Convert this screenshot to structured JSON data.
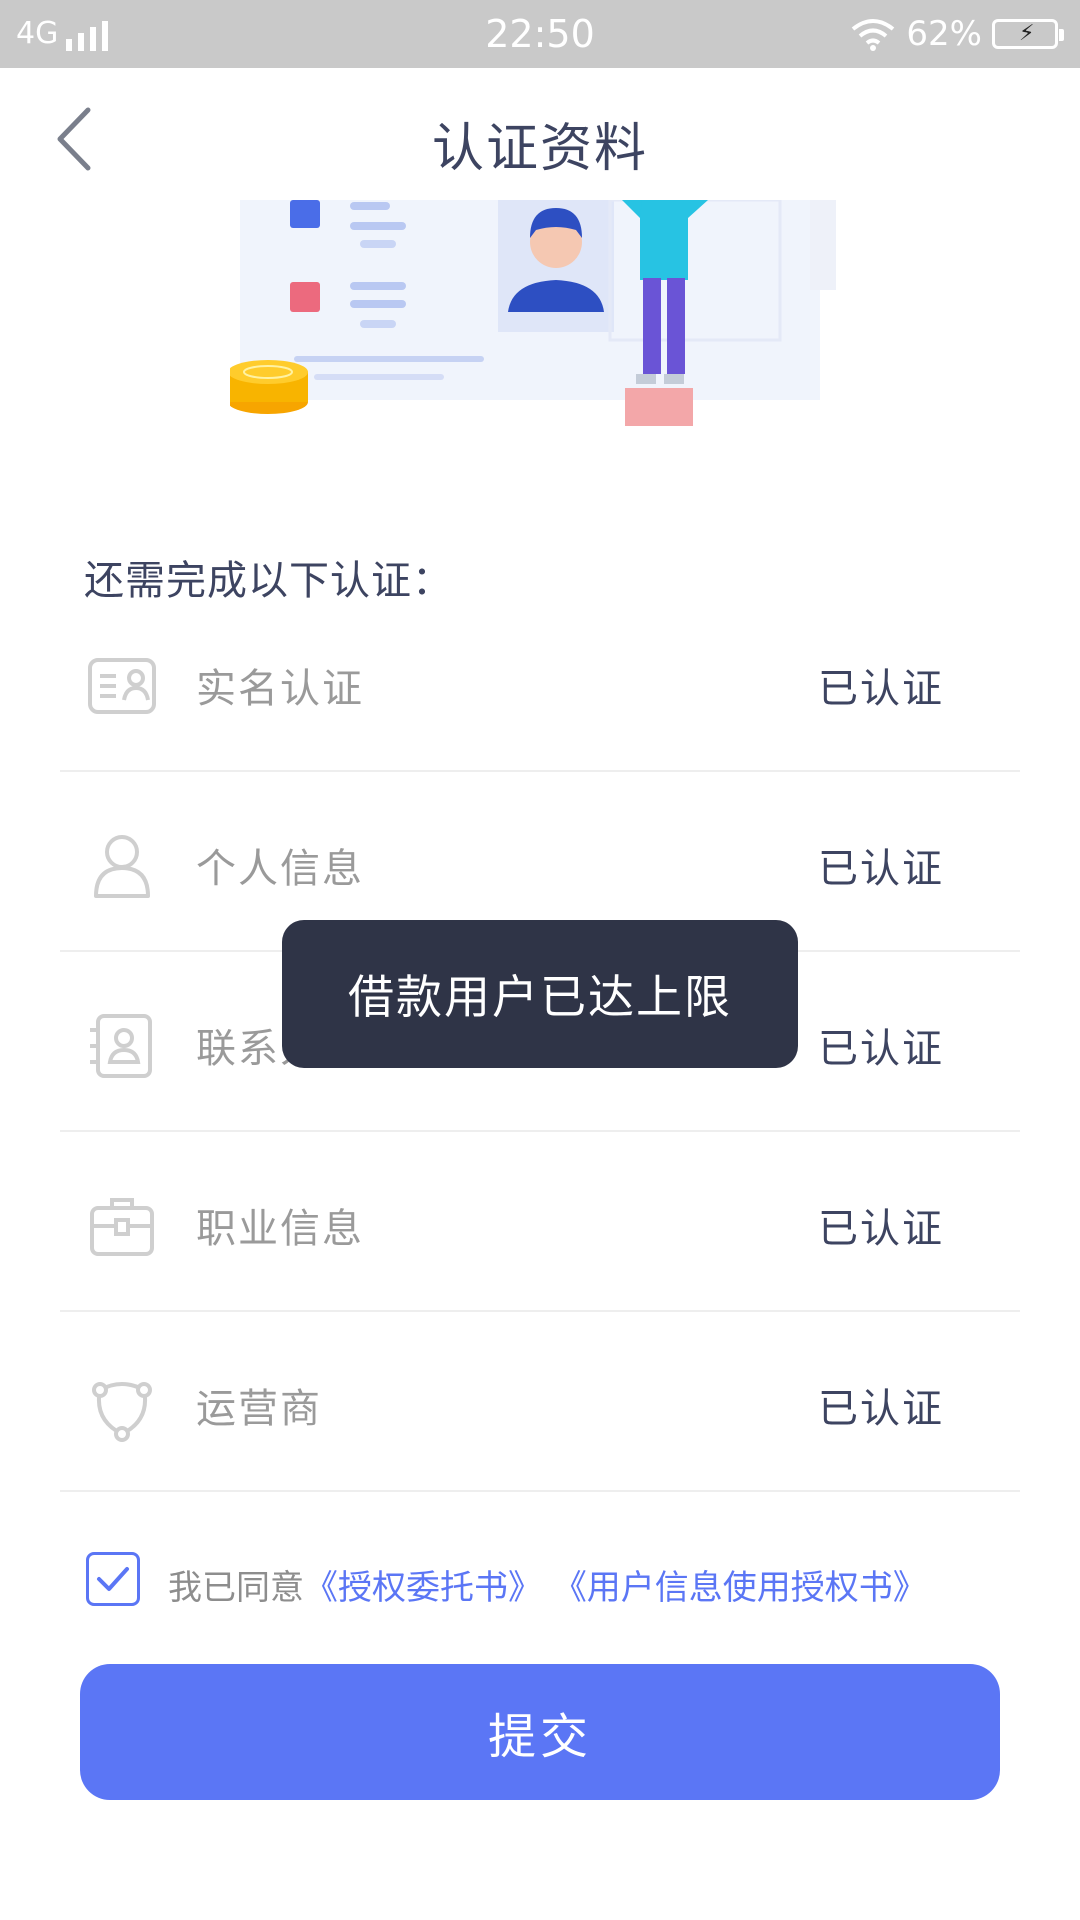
{
  "status_bar": {
    "network": "4G",
    "time": "22:50",
    "battery": "62%"
  },
  "header": {
    "title": "认证资料",
    "back_icon": "chevron-left-icon"
  },
  "section_title": "还需完成以下认证：",
  "items": [
    {
      "label": "实名认证",
      "status": "已认证",
      "icon": "id-card-icon"
    },
    {
      "label": "个人信息",
      "status": "已认证",
      "icon": "user-icon"
    },
    {
      "label": "联系人信息",
      "status": "已认证",
      "icon": "contact-card-icon"
    },
    {
      "label": "职业信息",
      "status": "已认证",
      "icon": "briefcase-icon"
    },
    {
      "label": "运营商",
      "status": "已认证",
      "icon": "network-icon"
    }
  ],
  "agreement": {
    "checked": true,
    "prefix": "我已同意",
    "link1": "《授权委托书》",
    "link2": "《用户信息使用授权书》"
  },
  "submit_label": "提交",
  "toast": "借款用户已达上限",
  "colors": {
    "accent": "#5b76f5",
    "title": "#3d4461",
    "toast_bg": "#2f3447"
  }
}
